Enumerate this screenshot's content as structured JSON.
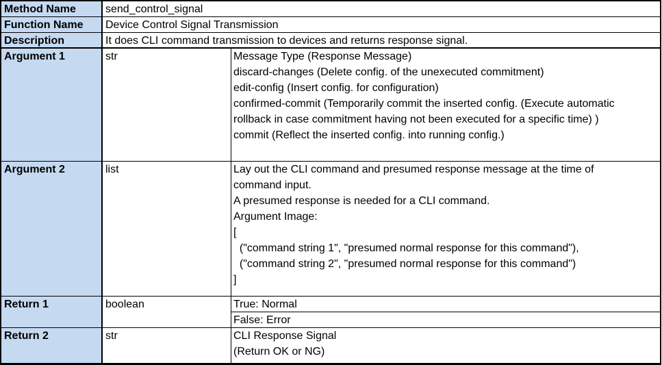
{
  "rows": {
    "method": {
      "label": "Method Name",
      "value": "send_control_signal"
    },
    "function": {
      "label": "Function Name",
      "value": "Device Control Signal Transmission"
    },
    "description": {
      "label": "Description",
      "value": "It does CLI command transmission to devices and returns response signal."
    },
    "arg1": {
      "label": "Argument 1",
      "type": "str",
      "lines": [
        "Message Type (Response Message)",
        "discard-changes (Delete config. of the unexecuted commitment)",
        "edit-config (Insert config. for configuration)",
        "confirmed-commit (Temporarily commit the inserted config. (Execute automatic",
        "rollback in case commitment having not been executed for a specific time) )",
        "commit (Reflect the inserted config. into running config.)"
      ]
    },
    "arg2": {
      "label": "Argument 2",
      "type": "list",
      "lines": [
        "Lay out the CLI command and presumed response message at the time of",
        "command input.",
        "A presumed response is needed for a CLI command.",
        "Argument Image:",
        "[",
        "  (\"command string 1\", \"presumed normal response for this command\"),",
        "  (\"command string 2\", \"presumed normal response for this command\")",
        "]"
      ]
    },
    "ret1": {
      "label": "Return 1",
      "type": "boolean",
      "true_text": "True: Normal",
      "false_text": "False: Error"
    },
    "ret2": {
      "label": "Return 2",
      "type": "str",
      "lines": [
        "CLI Response Signal",
        "(Return OK or NG)"
      ]
    }
  },
  "colors": {
    "header_bg": "#c5d9f1"
  }
}
